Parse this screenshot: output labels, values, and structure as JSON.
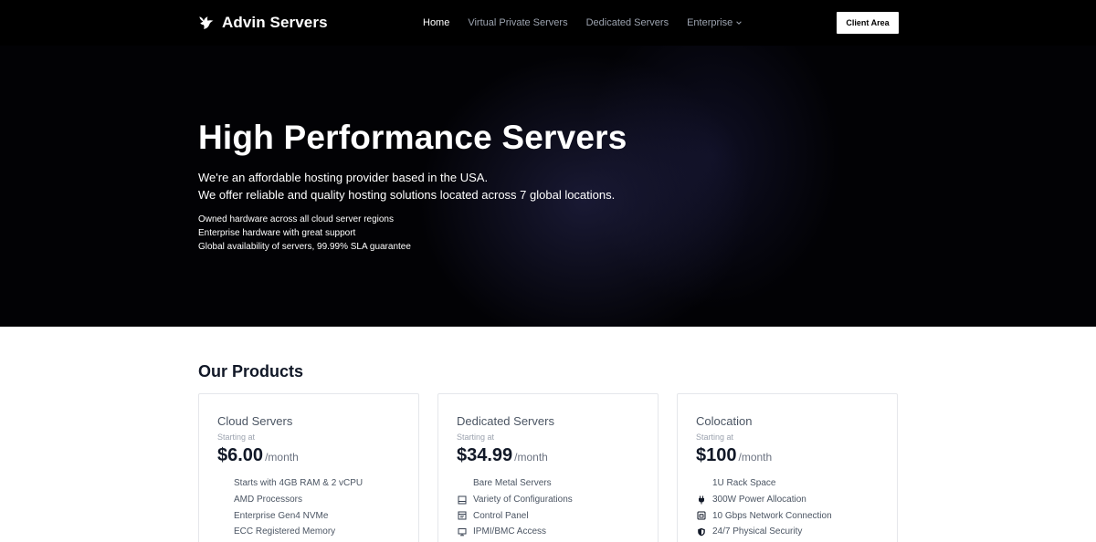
{
  "nav": {
    "brand": "Advin Servers",
    "links": [
      "Home",
      "Virtual Private Servers",
      "Dedicated Servers",
      "Enterprise"
    ],
    "client_area": "Client Area"
  },
  "hero": {
    "title": "High Performance Servers",
    "subtitle_lines": [
      "We're an affordable hosting provider based in the USA.",
      "We offer reliable and quality hosting solutions located across 7 global locations."
    ],
    "highlights": [
      "Owned hardware across all cloud server regions",
      "Enterprise hardware with great support",
      "Global availability of servers, 99.99% SLA guarantee"
    ]
  },
  "products": {
    "title": "Our Products",
    "cards": [
      {
        "name": "Cloud Servers",
        "starting": "Starting at",
        "price": "$6.00",
        "period": "/month",
        "features": [
          {
            "text": "Starts with 4GB RAM & 2 vCPU",
            "icon": "none"
          },
          {
            "text": "AMD Processors",
            "icon": "none"
          },
          {
            "text": "Enterprise Gen4 NVMe",
            "icon": "none"
          },
          {
            "text": "ECC Registered Memory",
            "icon": "none"
          }
        ]
      },
      {
        "name": "Dedicated Servers",
        "starting": "Starting at",
        "price": "$34.99",
        "period": "/month",
        "features": [
          {
            "text": "Bare Metal Servers",
            "icon": "none"
          },
          {
            "text": "Variety of Configurations",
            "icon": "server-icon"
          },
          {
            "text": "Control Panel",
            "icon": "window-icon"
          },
          {
            "text": "IPMI/BMC Access",
            "icon": "monitor-icon"
          }
        ]
      },
      {
        "name": "Colocation",
        "starting": "Starting at",
        "price": "$100",
        "period": "/month",
        "features": [
          {
            "text": "1U Rack Space",
            "icon": "none"
          },
          {
            "text": "300W Power Allocation",
            "icon": "plug-icon"
          },
          {
            "text": "10 Gbps Network Connection",
            "icon": "network-icon"
          },
          {
            "text": "24/7 Physical Security",
            "icon": "shield-icon"
          }
        ]
      }
    ]
  }
}
